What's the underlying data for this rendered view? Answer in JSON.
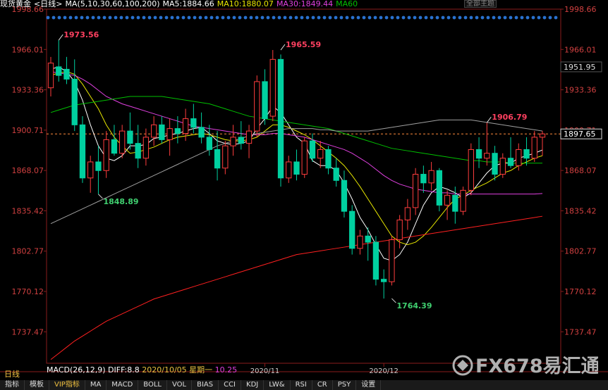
{
  "header": {
    "instrument": "现货黄金",
    "period": "<日线>",
    "ma_label": "MA(5,10,30,60,100,200)",
    "ma5": "MA5:1884.66",
    "ma10": "MA10:1880.07",
    "ma30": "MA30:1849.44",
    "ma60": "MA60",
    "main_label": "全部主题",
    "colors": {
      "ma5": "#ffffff",
      "ma10": "#e6e600",
      "ma30": "#e040e0",
      "ma60": "#00c000",
      "ma100": "#a0a0a0",
      "ma200": "#ff2020"
    }
  },
  "top_left_price": "1998.66",
  "period_corner": "日线",
  "macd": {
    "label": "MACD(26,12,9)",
    "diff": "DIFF:8.8",
    "date": "2020/10/05 星期一",
    "dea": "10.25"
  },
  "chart_data": {
    "type": "candlestick",
    "y_ticks": [
      "1998.66",
      "1966.01",
      "1933.36",
      "1900.71",
      "1868.07",
      "1835.42",
      "1802.77",
      "1770.12",
      "1737.47"
    ],
    "ylim": [
      1712,
      1998.66
    ],
    "x_labels": [
      {
        "label": "2020/11",
        "index": 27
      },
      {
        "label": "2020/12",
        "index": 42
      }
    ],
    "current_price": "1897.65",
    "marker_price": "1951.95",
    "ref_line": 1897.65,
    "annotations": [
      {
        "text": "1973.56",
        "index": 1,
        "value": 1973.56,
        "color": "#ff4060"
      },
      {
        "text": "1848.89",
        "index": 6,
        "value": 1848.89,
        "color": "#40d070"
      },
      {
        "text": "1965.59",
        "index": 29,
        "value": 1965.59,
        "color": "#ff4060"
      },
      {
        "text": "1764.39",
        "index": 43,
        "value": 1764.39,
        "color": "#40d070"
      },
      {
        "text": "1906.79",
        "index": 55,
        "value": 1906.79,
        "color": "#ff4060"
      }
    ],
    "candles": [
      {
        "o": 1935,
        "h": 1960,
        "l": 1928,
        "c": 1955
      },
      {
        "o": 1952,
        "h": 1973.56,
        "l": 1940,
        "c": 1945
      },
      {
        "o": 1950,
        "h": 1960,
        "l": 1938,
        "c": 1942
      },
      {
        "o": 1942,
        "h": 1958,
        "l": 1900,
        "c": 1905
      },
      {
        "o": 1905,
        "h": 1912,
        "l": 1858,
        "c": 1862
      },
      {
        "o": 1862,
        "h": 1880,
        "l": 1850,
        "c": 1875
      },
      {
        "o": 1875,
        "h": 1888,
        "l": 1848.89,
        "c": 1868
      },
      {
        "o": 1868,
        "h": 1900,
        "l": 1862,
        "c": 1893
      },
      {
        "o": 1893,
        "h": 1905,
        "l": 1880,
        "c": 1882
      },
      {
        "o": 1882,
        "h": 1905,
        "l": 1878,
        "c": 1900
      },
      {
        "o": 1900,
        "h": 1915,
        "l": 1885,
        "c": 1890
      },
      {
        "o": 1890,
        "h": 1905,
        "l": 1870,
        "c": 1878
      },
      {
        "o": 1878,
        "h": 1902,
        "l": 1872,
        "c": 1895
      },
      {
        "o": 1895,
        "h": 1912,
        "l": 1888,
        "c": 1905
      },
      {
        "o": 1905,
        "h": 1912,
        "l": 1890,
        "c": 1893
      },
      {
        "o": 1893,
        "h": 1910,
        "l": 1880,
        "c": 1902
      },
      {
        "o": 1902,
        "h": 1912,
        "l": 1890,
        "c": 1898
      },
      {
        "o": 1898,
        "h": 1918,
        "l": 1892,
        "c": 1910
      },
      {
        "o": 1910,
        "h": 1922,
        "l": 1898,
        "c": 1903
      },
      {
        "o": 1903,
        "h": 1915,
        "l": 1890,
        "c": 1895
      },
      {
        "o": 1895,
        "h": 1905,
        "l": 1880,
        "c": 1885
      },
      {
        "o": 1885,
        "h": 1900,
        "l": 1860,
        "c": 1870
      },
      {
        "o": 1870,
        "h": 1892,
        "l": 1865,
        "c": 1888
      },
      {
        "o": 1888,
        "h": 1905,
        "l": 1880,
        "c": 1895
      },
      {
        "o": 1895,
        "h": 1908,
        "l": 1885,
        "c": 1890
      },
      {
        "o": 1890,
        "h": 1905,
        "l": 1878,
        "c": 1900
      },
      {
        "o": 1900,
        "h": 1945,
        "l": 1895,
        "c": 1940
      },
      {
        "o": 1940,
        "h": 1950,
        "l": 1905,
        "c": 1910
      },
      {
        "o": 1912,
        "h": 1965.59,
        "l": 1908,
        "c": 1958
      },
      {
        "o": 1958,
        "h": 1962,
        "l": 1855,
        "c": 1862
      },
      {
        "o": 1862,
        "h": 1880,
        "l": 1858,
        "c": 1875
      },
      {
        "o": 1875,
        "h": 1885,
        "l": 1860,
        "c": 1865
      },
      {
        "o": 1865,
        "h": 1895,
        "l": 1862,
        "c": 1892
      },
      {
        "o": 1892,
        "h": 1898,
        "l": 1875,
        "c": 1878
      },
      {
        "o": 1878,
        "h": 1892,
        "l": 1870,
        "c": 1885
      },
      {
        "o": 1885,
        "h": 1888,
        "l": 1865,
        "c": 1870
      },
      {
        "o": 1870,
        "h": 1878,
        "l": 1855,
        "c": 1860
      },
      {
        "o": 1860,
        "h": 1868,
        "l": 1830,
        "c": 1835
      },
      {
        "o": 1835,
        "h": 1840,
        "l": 1800,
        "c": 1805
      },
      {
        "o": 1805,
        "h": 1820,
        "l": 1800,
        "c": 1815
      },
      {
        "o": 1815,
        "h": 1822,
        "l": 1795,
        "c": 1810
      },
      {
        "o": 1810,
        "h": 1815,
        "l": 1775,
        "c": 1780
      },
      {
        "o": 1780,
        "h": 1788,
        "l": 1764.39,
        "c": 1778
      },
      {
        "o": 1778,
        "h": 1815,
        "l": 1775,
        "c": 1812
      },
      {
        "o": 1812,
        "h": 1832,
        "l": 1805,
        "c": 1828
      },
      {
        "o": 1828,
        "h": 1845,
        "l": 1820,
        "c": 1838
      },
      {
        "o": 1838,
        "h": 1870,
        "l": 1832,
        "c": 1865
      },
      {
        "o": 1865,
        "h": 1872,
        "l": 1850,
        "c": 1858
      },
      {
        "o": 1858,
        "h": 1875,
        "l": 1852,
        "c": 1868
      },
      {
        "o": 1868,
        "h": 1870,
        "l": 1835,
        "c": 1840
      },
      {
        "o": 1840,
        "h": 1852,
        "l": 1828,
        "c": 1848
      },
      {
        "o": 1848,
        "h": 1855,
        "l": 1825,
        "c": 1835
      },
      {
        "o": 1835,
        "h": 1855,
        "l": 1832,
        "c": 1852
      },
      {
        "o": 1852,
        "h": 1890,
        "l": 1848,
        "c": 1885
      },
      {
        "o": 1885,
        "h": 1895,
        "l": 1870,
        "c": 1878
      },
      {
        "o": 1878,
        "h": 1906.79,
        "l": 1872,
        "c": 1882
      },
      {
        "o": 1882,
        "h": 1888,
        "l": 1860,
        "c": 1865
      },
      {
        "o": 1865,
        "h": 1882,
        "l": 1862,
        "c": 1878
      },
      {
        "o": 1878,
        "h": 1895,
        "l": 1870,
        "c": 1872
      },
      {
        "o": 1872,
        "h": 1890,
        "l": 1868,
        "c": 1885
      },
      {
        "o": 1885,
        "h": 1895,
        "l": 1872,
        "c": 1878
      },
      {
        "o": 1878,
        "h": 1900,
        "l": 1875,
        "c": 1895
      },
      {
        "o": 1895,
        "h": 1900,
        "l": 1880,
        "c": 1897.65
      }
    ],
    "ma_lines": [
      {
        "name": "MA5",
        "color": "#ffffff",
        "values": [
          1950,
          1952,
          1948,
          1940,
          1925,
          1905,
          1888,
          1878,
          1876,
          1880,
          1888,
          1888,
          1889,
          1894,
          1895,
          1897,
          1898,
          1900,
          1902,
          1903,
          1898,
          1892,
          1890,
          1889,
          1890,
          1892,
          1902,
          1910,
          1920,
          1915,
          1905,
          1895,
          1890,
          1876,
          1872,
          1872,
          1868,
          1858,
          1845,
          1830,
          1820,
          1808,
          1797,
          1795,
          1800,
          1810,
          1825,
          1840,
          1850,
          1855,
          1853,
          1850,
          1846,
          1850,
          1858,
          1866,
          1872,
          1874,
          1874,
          1878,
          1880,
          1882,
          1884.66
        ]
      },
      {
        "name": "MA10",
        "color": "#e6e600",
        "values": [
          1945,
          1947,
          1948,
          1946,
          1938,
          1928,
          1918,
          1905,
          1895,
          1888,
          1882,
          1883,
          1885,
          1887,
          1890,
          1893,
          1895,
          1896,
          1897,
          1898,
          1897,
          1895,
          1893,
          1892,
          1892,
          1893,
          1895,
          1900,
          1905,
          1905,
          1903,
          1900,
          1897,
          1893,
          1888,
          1883,
          1878,
          1872,
          1864,
          1855,
          1845,
          1835,
          1825,
          1815,
          1810,
          1808,
          1810,
          1815,
          1822,
          1830,
          1838,
          1845,
          1848,
          1852,
          1855,
          1858,
          1862,
          1866,
          1868,
          1872,
          1875,
          1878,
          1880.07
        ]
      },
      {
        "name": "MA30",
        "color": "#e040e0",
        "values": [
          1948,
          1947,
          1946,
          1945,
          1942,
          1938,
          1933,
          1928,
          1925,
          1922,
          1920,
          1918,
          1916,
          1914,
          1912,
          1910,
          1908,
          1906,
          1904,
          1903,
          1902,
          1901,
          1900,
          1899,
          1898,
          1897,
          1897,
          1897,
          1898,
          1898,
          1897,
          1896,
          1895,
          1893,
          1891,
          1889,
          1887,
          1885,
          1882,
          1878,
          1874,
          1869,
          1864,
          1860,
          1857,
          1855,
          1853,
          1852,
          1851,
          1850,
          1850,
          1849,
          1849,
          1849,
          1849,
          1849,
          1849,
          1849,
          1849,
          1849,
          1849,
          1849,
          1849.44
        ]
      },
      {
        "name": "MA60",
        "color": "#00c000",
        "values": [
          1915,
          1917,
          1919,
          1921,
          1922,
          1923,
          1924,
          1925,
          1926,
          1927,
          1928,
          1928,
          1928,
          1928,
          1928,
          1927,
          1926,
          1925,
          1924,
          1923,
          1922,
          1920,
          1918,
          1916,
          1914,
          1912,
          1911,
          1910,
          1909,
          1908,
          1907,
          1906,
          1905,
          1904,
          1903,
          1902,
          1900,
          1898,
          1896,
          1894,
          1892,
          1890,
          1888,
          1886,
          1885,
          1884,
          1883,
          1882,
          1881,
          1880,
          1879,
          1878,
          1877,
          1876,
          1876,
          1875,
          1875,
          1875,
          1874,
          1874,
          1874,
          1874,
          1874
        ]
      },
      {
        "name": "MA100",
        "color": "#a0a0a0",
        "values": [
          1825,
          1828,
          1831,
          1834,
          1837,
          1840,
          1843,
          1846,
          1849,
          1852,
          1855,
          1858,
          1861,
          1864,
          1867,
          1870,
          1873,
          1876,
          1879,
          1882,
          1885,
          1888,
          1890,
          1892,
          1894,
          1896,
          1898,
          1899,
          1900,
          1901,
          1902,
          1902,
          1902,
          1902,
          1901,
          1901,
          1900,
          1900,
          1900,
          1900,
          1900,
          1901,
          1902,
          1903,
          1904,
          1905,
          1906,
          1907,
          1908,
          1909,
          1909,
          1909,
          1909,
          1909,
          1908,
          1907,
          1906,
          1905,
          1904,
          1903,
          1902,
          1901,
          1900
        ]
      },
      {
        "name": "MA200",
        "color": "#ff2020",
        "values": [
          1715,
          1720,
          1725,
          1730,
          1734,
          1738,
          1742,
          1746,
          1749,
          1752,
          1755,
          1758,
          1761,
          1764,
          1766,
          1768,
          1770,
          1772,
          1774,
          1776,
          1778,
          1780,
          1782,
          1784,
          1786,
          1788,
          1790,
          1792,
          1794,
          1796,
          1798,
          1800,
          1801,
          1802,
          1803,
          1804,
          1805,
          1806,
          1807,
          1808,
          1809,
          1810,
          1811,
          1812,
          1813,
          1814,
          1815,
          1816,
          1817,
          1818,
          1819,
          1820,
          1821,
          1822,
          1823,
          1824,
          1825,
          1826,
          1827,
          1828,
          1829,
          1830,
          1831
        ]
      }
    ]
  },
  "bottom_tabs": [
    "指标",
    "模板",
    "VIP指标",
    "MA",
    "MACD",
    "BOLL",
    "VOL",
    "BIAS",
    "CCI",
    "KDJ",
    "LW&",
    "RSI",
    "CR",
    "PSY",
    "设置"
  ],
  "watermark": "FX678易汇通"
}
